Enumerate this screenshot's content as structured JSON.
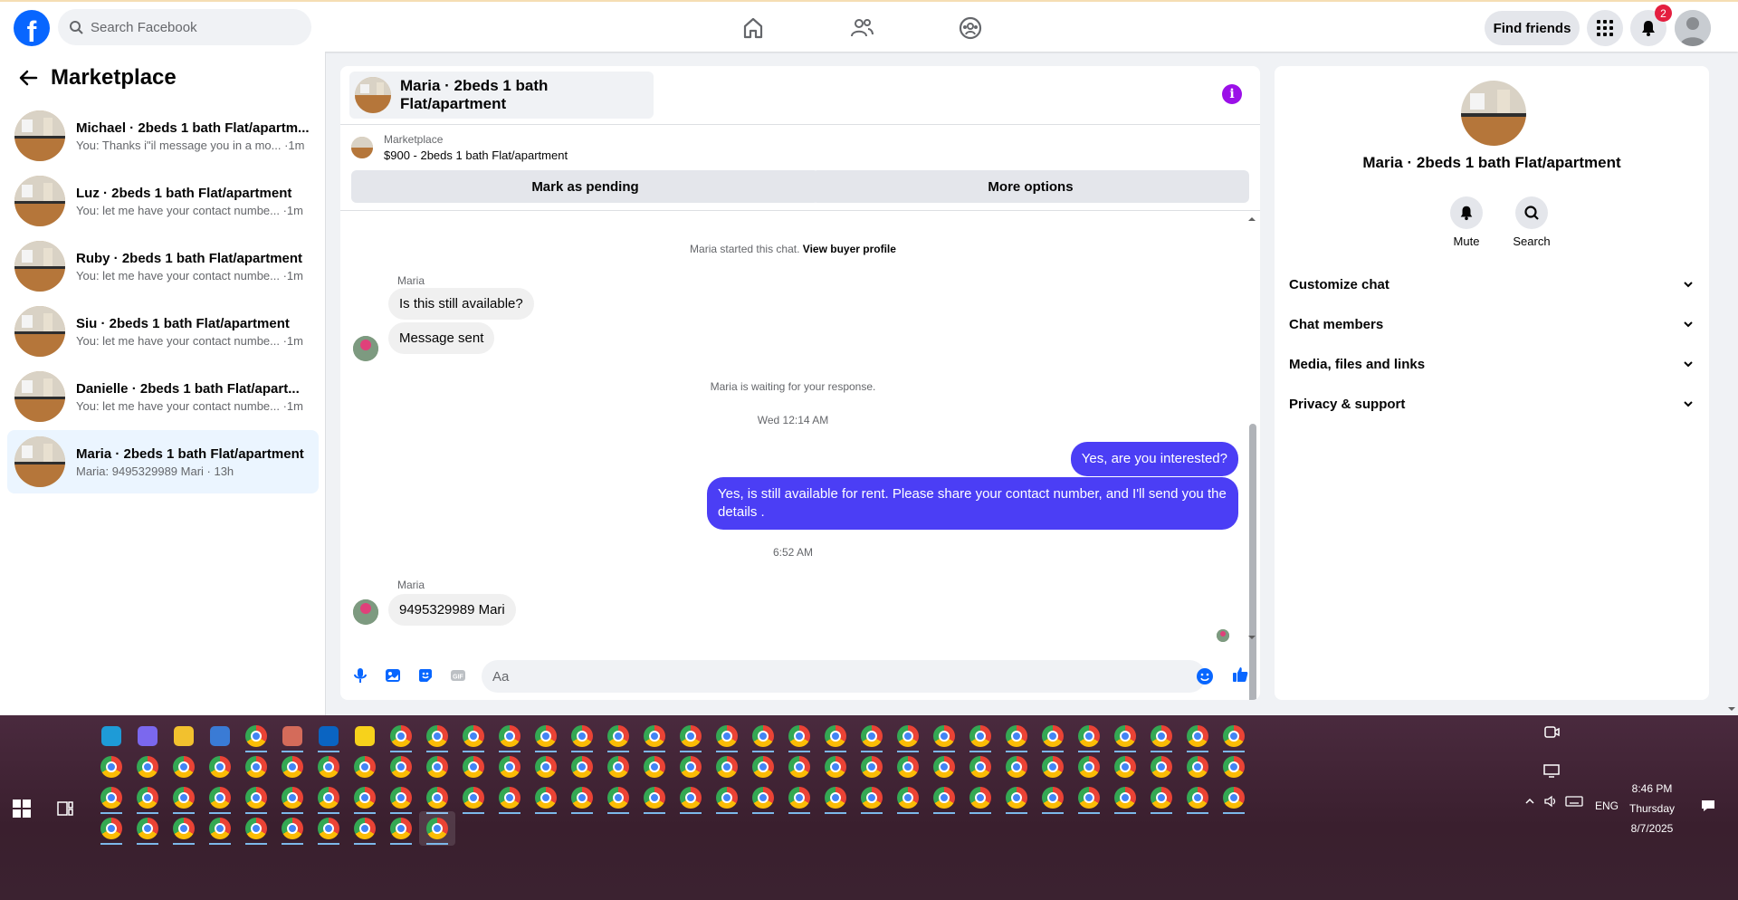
{
  "topbar": {
    "search_placeholder": "Search Facebook",
    "find_friends": "Find friends",
    "notification_count": "2"
  },
  "sidebar": {
    "title": "Marketplace",
    "conversations": [
      {
        "title": "Michael · 2beds 1 bath Flat/apartm...",
        "preview": "You: Thanks i\"il message you in a mo... ·1m",
        "active": false
      },
      {
        "title": "Luz · 2beds 1 bath Flat/apartment",
        "preview": "You: let me have your contact numbe... ·1m",
        "active": false
      },
      {
        "title": "Ruby · 2beds 1 bath Flat/apartment",
        "preview": "You: let me have your contact numbe... ·1m",
        "active": false
      },
      {
        "title": "Siu · 2beds 1 bath Flat/apartment",
        "preview": "You: let me have your contact numbe... ·1m",
        "active": false
      },
      {
        "title": "Danielle · 2beds 1 bath Flat/apart...",
        "preview": "You: let me have your contact numbe... ·1m",
        "active": false
      },
      {
        "title": "Maria · 2beds 1 bath Flat/apartment",
        "preview": "Maria: 9495329989 Mari · 13h",
        "active": true
      }
    ]
  },
  "chat": {
    "header_title": "Maria · 2beds 1 bath Flat/apartment",
    "marketplace_label": "Marketplace",
    "listing": "$900 - 2beds 1 bath Flat/apartment",
    "mark_pending": "Mark as pending",
    "more_options": "More options",
    "started_text": "Maria started this chat.",
    "view_buyer_profile": "View buyer profile",
    "sender1": "Maria",
    "msg1": "Is this still available?",
    "msg2": "Message sent",
    "waiting": "Maria is waiting for your response.",
    "time1": "Wed 12:14 AM",
    "out1": "Yes, are you interested?",
    "out2": "Yes, is still available for rent. Please share your contact number, and I'll send you the details .",
    "time2": "6:52 AM",
    "sender2": "Maria",
    "msg3": "9495329989 Mari",
    "composer_placeholder": "Aa"
  },
  "right_panel": {
    "title": "Maria · 2beds 1 bath Flat/apartment",
    "mute": "Mute",
    "search": "Search",
    "sections": [
      "Customize chat",
      "Chat members",
      "Media, files and links",
      "Privacy & support"
    ]
  },
  "taskbar": {
    "language": "ENG",
    "time": "8:46 PM",
    "day": "Thursday",
    "date": "8/7/2025"
  },
  "colors": {
    "brand": "#0866ff",
    "outgoing_bubble": "#4b3ef5",
    "info_icon": "#9b10e8",
    "badge": "#e41e3f"
  }
}
